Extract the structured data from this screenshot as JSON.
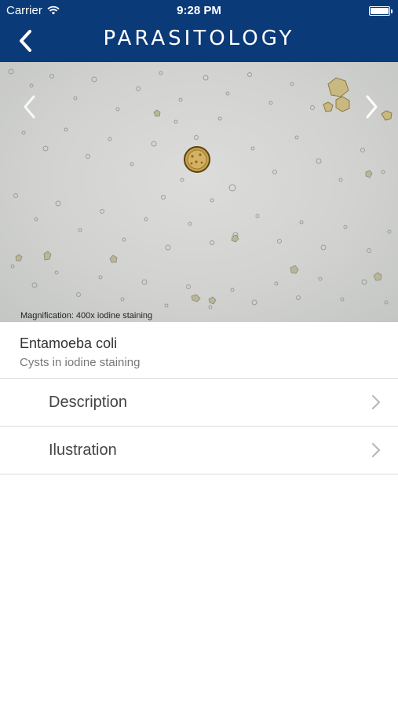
{
  "status_bar": {
    "carrier": "Carrier",
    "time": "9:28 PM"
  },
  "nav": {
    "title": "PARASITOLOGY",
    "back_icon": "chevron-left-icon"
  },
  "image": {
    "caption": "Magnification: 400x iodine staining",
    "prev_icon": "chevron-left-icon",
    "next_icon": "chevron-right-icon"
  },
  "specimen": {
    "name": "Entamoeba coli",
    "subtitle": "Cysts in iodine staining"
  },
  "menu": {
    "items": [
      {
        "label": "Description"
      },
      {
        "label": "Ilustration"
      }
    ]
  },
  "colors": {
    "nav_bar": "#0b3a78",
    "background": "#ffffff"
  }
}
